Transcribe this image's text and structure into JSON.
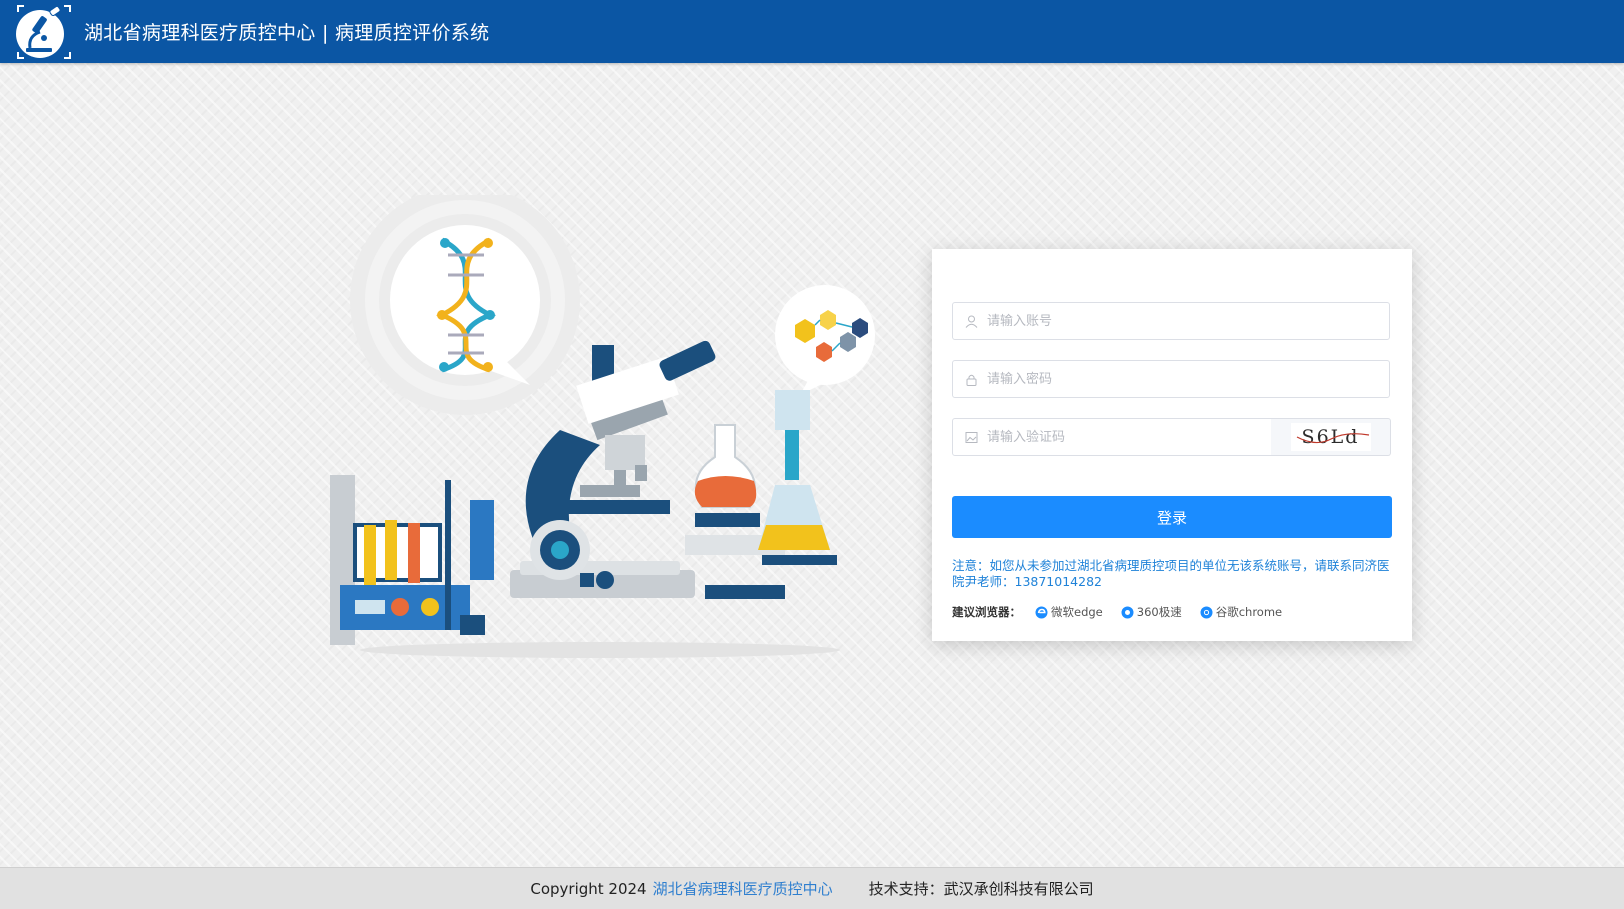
{
  "header": {
    "title": "湖北省病理科医疗质控中心 | 病理质控评价系统",
    "logo_icon": "microscope-logo-icon"
  },
  "login": {
    "account_placeholder": "请输入账号",
    "password_placeholder": "请输入密码",
    "captcha_placeholder": "请输入验证码",
    "captcha_text": "S6Ld",
    "login_label": "登录",
    "notice": "注意：如您从未参加过湖北省病理质控项目的单位无该系统账号，请联系同济医院尹老师：13871014282",
    "browsers_label": "建议浏览器：",
    "browsers": [
      {
        "name": "微软edge",
        "icon": "edge-icon"
      },
      {
        "name": "360极速",
        "icon": "360-browser-icon"
      },
      {
        "name": "谷歌chrome",
        "icon": "chrome-icon"
      }
    ]
  },
  "footer": {
    "copyright": "Copyright 2024",
    "org": "湖北省病理科医疗质控中心",
    "support": "技术支持：武汉承创科技有限公司"
  },
  "colors": {
    "header_bg": "#0b56a4",
    "button_bg": "#1b8cff",
    "notice_text": "#1f82d8",
    "footer_link": "#2f7fcf"
  }
}
